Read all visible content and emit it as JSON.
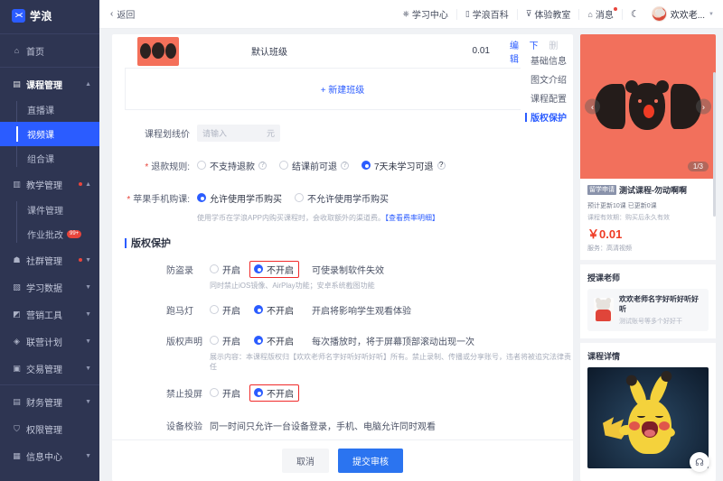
{
  "brand": {
    "name": "学浪",
    "logo_icon": "wave-logo-icon"
  },
  "sidebar": {
    "items": [
      {
        "label": "首页",
        "icon": "home-icon",
        "type": "item"
      },
      {
        "label": "课程管理",
        "icon": "book-icon",
        "type": "group",
        "expanded": true,
        "chevron": "chevron-up-icon"
      },
      {
        "label": "直播课",
        "type": "sub"
      },
      {
        "label": "视频课",
        "type": "sub",
        "active": true
      },
      {
        "label": "组合课",
        "type": "sub"
      },
      {
        "label": "教学管理",
        "icon": "teach-icon",
        "type": "group",
        "expanded": true,
        "dot": true,
        "chevron": "chevron-up-icon"
      },
      {
        "label": "课件管理",
        "type": "sub"
      },
      {
        "label": "作业批改",
        "type": "sub",
        "badge": "99+"
      },
      {
        "label": "社群管理",
        "icon": "community-icon",
        "type": "group",
        "dot": true,
        "chevron": "chevron-down-icon"
      },
      {
        "label": "学习数据",
        "icon": "data-icon",
        "type": "group",
        "chevron": "chevron-down-icon"
      },
      {
        "label": "营销工具",
        "icon": "marketing-icon",
        "type": "group",
        "chevron": "chevron-down-icon"
      },
      {
        "label": "联营计划",
        "icon": "plan-icon",
        "type": "group",
        "chevron": "chevron-down-icon"
      },
      {
        "label": "交易管理",
        "icon": "trade-icon",
        "type": "group",
        "chevron": "chevron-down-icon"
      },
      {
        "label": "财务管理",
        "icon": "finance-icon",
        "type": "group",
        "chevron": "chevron-down-icon"
      },
      {
        "label": "权限管理",
        "icon": "shield-icon",
        "type": "item"
      },
      {
        "label": "信息中心",
        "icon": "info-icon",
        "type": "group",
        "chevron": "chevron-down-icon"
      }
    ]
  },
  "topbar": {
    "back_label": "返回",
    "back_icon": "chevron-left-icon",
    "links": [
      {
        "label": "学习中心",
        "icon": "graduation-icon"
      },
      {
        "label": "学浪百科",
        "icon": "book-open-icon"
      },
      {
        "label": "体验教室",
        "icon": "monitor-icon"
      },
      {
        "label": "消息",
        "icon": "bell-icon",
        "dot": true
      }
    ],
    "theme_toggle_icon": "moon-icon",
    "user": {
      "name": "欢欢老...",
      "avatar_icon": "user-avatar",
      "caret_icon": "caret-down-icon"
    }
  },
  "rail": {
    "items": [
      {
        "label": "基础信息",
        "active": false
      },
      {
        "label": "图文介绍",
        "active": false
      },
      {
        "label": "课程配置",
        "active": false
      },
      {
        "label": "版权保护",
        "active": true
      }
    ]
  },
  "table": {
    "row": {
      "thumb_icon": "course-cover-thumb",
      "class_name": "默认班级",
      "price": "0.01",
      "actions": [
        {
          "label": "编辑",
          "disabled": false
        },
        {
          "label": "下架",
          "disabled": false
        },
        {
          "label": "删除",
          "disabled": true
        }
      ]
    },
    "add_class_label": "+ 新建班级"
  },
  "form": {
    "strike_price": {
      "label": "课程划线价",
      "placeholder": "请输入",
      "unit": "元",
      "value": ""
    },
    "refund": {
      "label": "退款规则:",
      "required": true,
      "options": [
        {
          "label": "不支持退款",
          "selected": false,
          "help_icon": "question-icon"
        },
        {
          "label": "结课前可退",
          "selected": false,
          "help_icon": "question-icon"
        },
        {
          "label": "7天未学习可退",
          "selected": true,
          "help_icon": "question-icon"
        }
      ]
    },
    "apple_purchase": {
      "label": "苹果手机购课:",
      "required": true,
      "options": [
        {
          "label": "允许使用学币购买",
          "selected": true
        },
        {
          "label": "不允许使用学币购买",
          "selected": false
        }
      ],
      "hint": "使用学币在学浪APP内购买课程时，会收取额外的渠道费。",
      "hint_link": "【查看费率明细】"
    },
    "copyright_section_title": "版权保护",
    "protections": [
      {
        "label": "防盗录",
        "options": [
          {
            "label": "开启",
            "selected": false
          },
          {
            "label": "不开启",
            "selected": true,
            "highlighted": true
          }
        ],
        "note": "可使录制软件失效",
        "sub": "同时禁止iOS镜像、AirPlay功能；安卓系统截图功能"
      },
      {
        "label": "跑马灯",
        "options": [
          {
            "label": "开启",
            "selected": false
          },
          {
            "label": "不开启",
            "selected": true,
            "highlighted": false
          }
        ],
        "note": "开启将影响学生观看体验",
        "sub": ""
      },
      {
        "label": "版权声明",
        "options": [
          {
            "label": "开启",
            "selected": false
          },
          {
            "label": "不开启",
            "selected": true,
            "highlighted": false
          }
        ],
        "note": "每次播放时，将于屏幕顶部滚动出现一次",
        "sub": "展示内容：本课程版权归【欢欢老师名字好听好听好听】所有。禁止录制、传播或分享账号，违者将被追究法律责任"
      },
      {
        "label": "禁止投屏",
        "options": [
          {
            "label": "开启",
            "selected": false
          },
          {
            "label": "不开启",
            "selected": true,
            "highlighted": true
          }
        ],
        "note": "",
        "sub": ""
      }
    ],
    "device_check": {
      "label": "设备校验",
      "note": "同一时间只允许一台设备登录，手机、电脑允许同时观看"
    }
  },
  "footer": {
    "cancel_label": "取消",
    "submit_label": "提交审核"
  },
  "preview": {
    "hero": {
      "cover_icon": "cub-cover-art",
      "prev_icon": "chevron-left-icon",
      "next_icon": "chevron-right-icon",
      "page_indicator": "1/3"
    },
    "tag": "留学申请",
    "title": "测试课程-勿动啊啊",
    "update_info": "预计更新10课  已更新0课",
    "validity": "课程有效期：购买后永久有效",
    "price": "￥0.01",
    "service": "服务：高清视频",
    "teacher_section_title": "授课老师",
    "teacher": {
      "name": "欢欢老师名字好听好听好听",
      "desc": "测试账号等多个好好干",
      "avatar_icon": "teacher-avatar"
    },
    "detail_section_title": "课程详情",
    "detail_image_icon": "pikachu-image",
    "support_icon": "headset-icon"
  },
  "colors": {
    "brand_blue": "#2b5cff",
    "sidebar_bg": "#2e3552",
    "highlight_red": "#f02a2a",
    "price_red": "#ef3b24",
    "accent_orange": "#f2705c"
  }
}
